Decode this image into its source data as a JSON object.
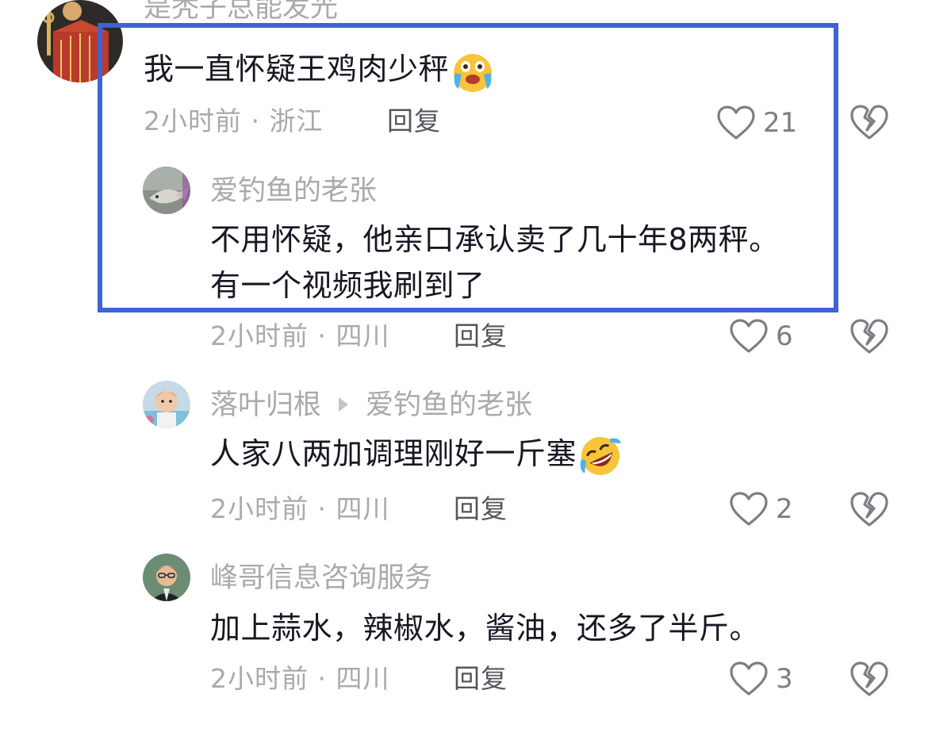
{
  "comments": [
    {
      "username": "是秃子总能发光",
      "text": "我一直怀疑王鸡肉少秤",
      "emoji": "crying-laughing-emoji",
      "meta": "2小时前 · 浙江",
      "reply_label": "回复",
      "likes": "21"
    },
    {
      "username": "爱钓鱼的老张",
      "text_line1": "不用怀疑，他亲口承认卖了几十年8两秤。",
      "text_line2": "有一个视频我刷到了",
      "meta": "2小时前 · 四川",
      "reply_label": "回复",
      "likes": "6"
    },
    {
      "username": "落叶归根",
      "reply_to": "爱钓鱼的老张",
      "text": "人家八两加调理刚好一斤塞",
      "emoji": "rolling-laughing-emoji",
      "meta": "2小时前 · 四川",
      "reply_label": "回复",
      "likes": "2"
    },
    {
      "username": "峰哥信息咨询服务",
      "text": "加上蒜水，辣椒水，酱油，还多了半斤。",
      "meta": "2小时前 · 四川",
      "reply_label": "回复",
      "likes": "3"
    }
  ],
  "colors": {
    "highlight": "#3d63d6",
    "text": "#161823",
    "muted": "#a9a9ae"
  },
  "icons": [
    "heart-icon",
    "broken-heart-icon",
    "play-triangle-icon"
  ]
}
